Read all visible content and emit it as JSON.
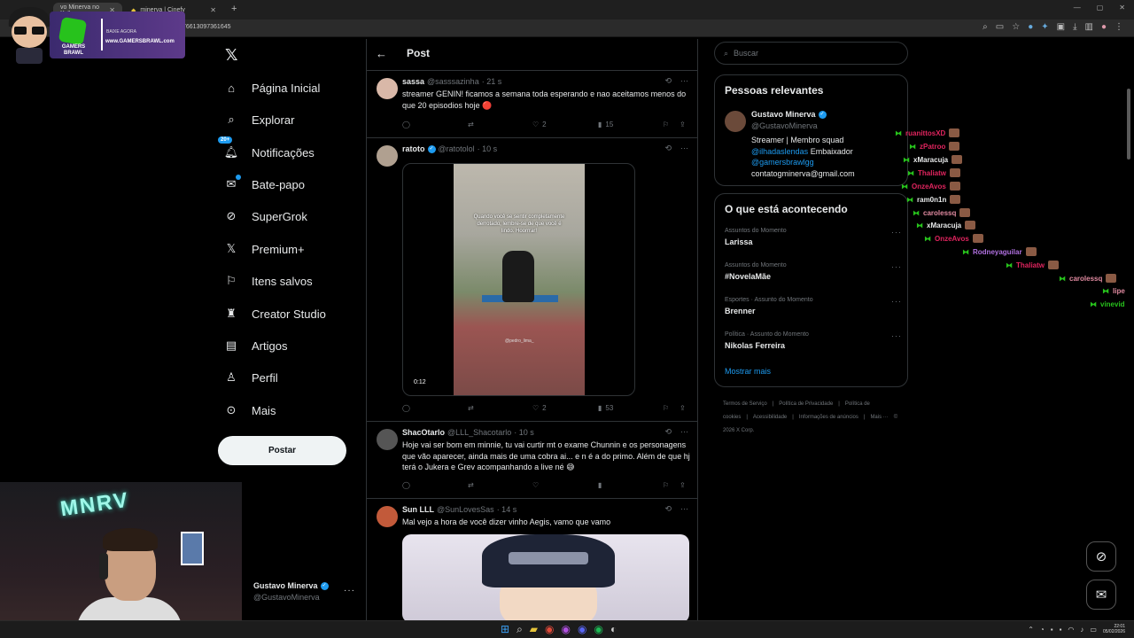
{
  "browser": {
    "tabs": [
      {
        "label": "vo Minerva no X: \"",
        "active": true
      },
      {
        "label": "minerva | Cinefy",
        "active": false
      }
    ],
    "url": "766130973616​45"
  },
  "overlay": {
    "brand_line1": "GAMERS",
    "brand_line2": "BRAWL",
    "cta": "BAIXE AGORA",
    "site": "www.GAMERSBRAWL.com"
  },
  "nav": {
    "items": [
      {
        "label": "Página Inicial",
        "icon": "home-icon"
      },
      {
        "label": "Explorar",
        "icon": "search-icon"
      },
      {
        "label": "Notificações",
        "icon": "bell-icon",
        "badge": "20+"
      },
      {
        "label": "Bate-papo",
        "icon": "mail-icon"
      },
      {
        "label": "SuperGrok",
        "icon": "grok-icon"
      },
      {
        "label": "Premium+",
        "icon": "x-icon"
      },
      {
        "label": "Itens salvos",
        "icon": "bookmark-icon"
      },
      {
        "label": "Creator Studio",
        "icon": "creator-icon"
      },
      {
        "label": "Artigos",
        "icon": "article-icon"
      },
      {
        "label": "Perfil",
        "icon": "person-icon"
      },
      {
        "label": "Mais",
        "icon": "more-circle-icon"
      }
    ],
    "post_button": "Postar",
    "account": {
      "name": "Gustavo Minerva",
      "handle": "@GustavoMinerva"
    }
  },
  "webcam": {
    "neon_text": "MNRV"
  },
  "main": {
    "header_title": "Post",
    "tweets": [
      {
        "name": "sassa",
        "handle": "@sasssazinha",
        "time": "· 21 s",
        "verified": false,
        "text": "streamer GENIN! ficamos a semana toda esperando e nao aceitamos menos do que 20 episodios hoje 🔴",
        "replies": "",
        "reposts": "",
        "likes": "2",
        "views": "15"
      },
      {
        "name": "ratoto",
        "handle": "@ratotolol",
        "time": "· 10 s",
        "verified": true,
        "video_caption": "Quando você se sentir completamente derrotado, lembre-se de que você é lindo. Hoorrrar!",
        "video_watermark": "@pedro_lima_",
        "video_time": "0:12",
        "replies": "",
        "reposts": "",
        "likes": "2",
        "views": "53"
      },
      {
        "name": "ShacOtarlo",
        "handle": "@LLL_Shacotarlo",
        "time": "· 10 s",
        "verified": false,
        "text": "Hoje vai ser bom em minnie, tu vai curtir mt o exame Chunnin e os personagens que vão aparecer, ainda mais de uma cobra ai... e n é a do primo. Além de que hj terá o Jukera e Grev acompanhando a live né 😅",
        "replies": "",
        "reposts": "",
        "likes": "",
        "views": ""
      },
      {
        "name": "Sun LLL",
        "handle": "@SunLovesSas",
        "time": "· 14 s",
        "verified": false,
        "text": "Mal vejo a hora de você dizer vinho Aegis, vamo que vamo"
      }
    ]
  },
  "sidebar": {
    "search_placeholder": "Buscar",
    "relevant": {
      "title": "Pessoas relevantes",
      "name": "Gustavo Minerva",
      "handle": "@GustavoMinerva",
      "bio_line1": "Streamer | Membro squad",
      "bio_link1": "@ilhadaslendas",
      "bio_after_link1": " Embaixador",
      "bio_link2": "@gamersbrawlgg",
      "bio_line4": "contatogminerva@gmail.com"
    },
    "trending": {
      "title": "O que está acontecendo",
      "items": [
        {
          "meta": "Assuntos do Momento",
          "name": "Larissa"
        },
        {
          "meta": "Assuntos do Momento",
          "name": "#NovelaMãe"
        },
        {
          "meta": "Esportes · Assunto do Momento",
          "name": "Brenner"
        },
        {
          "meta": "Política · Assunto do Momento",
          "name": "Nikolas Ferreira"
        }
      ],
      "show_more": "Mostrar mais"
    },
    "footer": [
      "Termos de Serviço",
      "|",
      "Política de Privacidade",
      "|",
      "Política de cookies",
      "|",
      "Acessibilidade",
      "|",
      "Informações de anúncios",
      "|",
      "Mais ···",
      "© 2026 X Corp."
    ]
  },
  "chat": [
    {
      "user": "ruanittosXD",
      "color": "#e0245e"
    },
    {
      "user": "zPatroo",
      "color": "#e0245e"
    },
    {
      "user": "xMaracuja",
      "color": "#e7e9ea"
    },
    {
      "user": "Thaliatw",
      "color": "#e0245e"
    },
    {
      "user": "OnzeAvos",
      "color": "#e0245e"
    },
    {
      "user": "ram0n1n",
      "color": "#e7e9ea"
    },
    {
      "user": "carolessq",
      "color": "#e08aa0"
    },
    {
      "user": "xMaracuja",
      "color": "#e7e9ea"
    },
    {
      "user": "OnzeAvos",
      "color": "#e0245e"
    },
    {
      "user": "Rodneyaguilar",
      "color": "#b070e0"
    },
    {
      "user": "Thaliatw",
      "color": "#e0245e"
    },
    {
      "user": "carolessq",
      "color": "#e08aa0"
    },
    {
      "user": "lipe",
      "color": "#e08aa0"
    },
    {
      "user": "vinevid",
      "color": "#27c21c"
    }
  ],
  "taskbar": {
    "time": "22:01",
    "date": "05/02/2026"
  },
  "colors": {
    "accent": "#1d9bf0",
    "border": "#2f3336",
    "muted": "#71767b"
  }
}
